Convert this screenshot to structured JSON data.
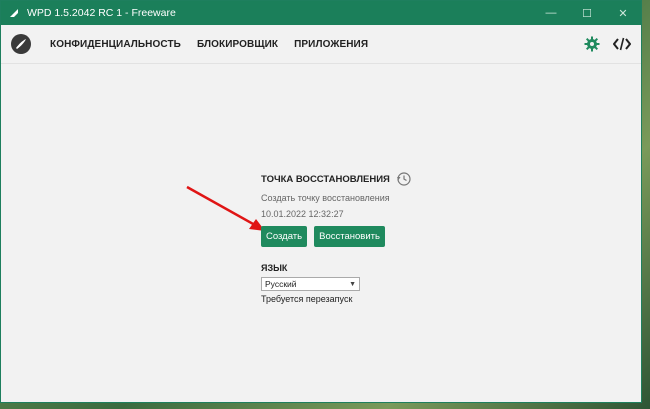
{
  "window": {
    "title": "WPD 1.5.2042 RC 1 - Freeware",
    "controls": {
      "minimize": "—",
      "maximize": "☐",
      "close": "✕"
    }
  },
  "nav": {
    "items": [
      {
        "label": "КОНФИДЕНЦИАЛЬНОСТЬ"
      },
      {
        "label": "БЛОКИРОВЩИК"
      },
      {
        "label": "ПРИЛОЖЕНИЯ"
      }
    ]
  },
  "tools": {
    "settings_icon": "gear-icon",
    "code_icon": "code-icon"
  },
  "restore": {
    "title": "ТОЧКА ВОССТАНОВЛЕНИЯ",
    "subtitle": "Создать точку восстановления",
    "date": "10.01.2022 12:32:27",
    "create_label": "Создать",
    "restore_label": "Восстановить"
  },
  "language": {
    "label": "ЯЗЫК",
    "selected": "Русский",
    "note": "Требуется перезапуск"
  },
  "colors": {
    "accent": "#1f8a5e",
    "titlebar": "#1b7f5a",
    "arrow": "#e01515"
  }
}
